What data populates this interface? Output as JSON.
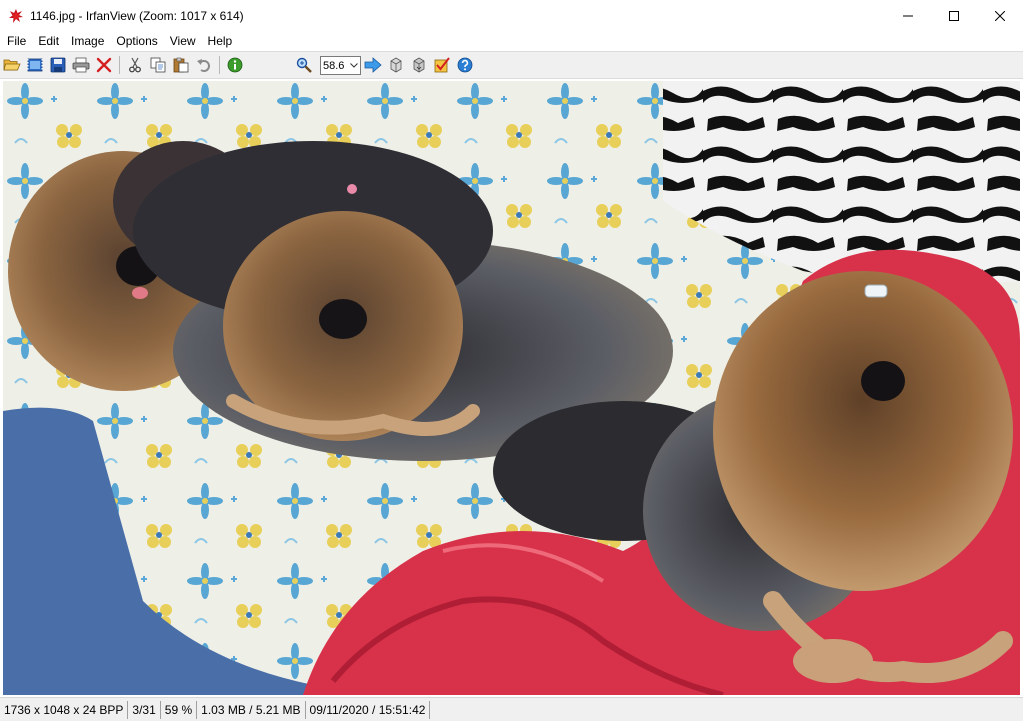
{
  "window": {
    "title": "1146.jpg - IrfanView (Zoom: 1017 x 614)",
    "app_icon": "irfanview-splat-icon",
    "controls": [
      "minimize-icon",
      "maximize-icon",
      "close-icon"
    ]
  },
  "menu": {
    "items": [
      {
        "label": "File"
      },
      {
        "label": "Edit"
      },
      {
        "label": "Image"
      },
      {
        "label": "Options"
      },
      {
        "label": "View"
      },
      {
        "label": "Help"
      }
    ]
  },
  "toolbar": {
    "buttons": [
      {
        "icon": "open-folder-icon"
      },
      {
        "icon": "slideshow-icon"
      },
      {
        "icon": "save-icon"
      },
      {
        "icon": "print-icon"
      },
      {
        "icon": "delete-icon"
      },
      {
        "icon": "cut-icon"
      },
      {
        "icon": "copy-icon"
      },
      {
        "icon": "paste-icon"
      },
      {
        "icon": "undo-icon"
      },
      {
        "icon": "info-icon"
      },
      {
        "icon": "zoom-icon"
      },
      {
        "icon": "next-arrow-icon"
      },
      {
        "icon": "rotate-left-icon"
      },
      {
        "icon": "rotate-right-icon"
      },
      {
        "icon": "check-options-icon"
      },
      {
        "icon": "help-icon"
      }
    ],
    "zoom_value": "58.6",
    "accent": "#2a7fd4"
  },
  "status": {
    "dimensions": "1736 x 1048 x 24 BPP",
    "index": "3/31",
    "zoom": "59 %",
    "size": "1.03 MB / 5.21 MB",
    "datetime": "09/11/2020 / 15:51:42"
  },
  "photo": {
    "colors": {
      "blanket_red": "#d8324a",
      "sofa_blue": "#4a6fa8",
      "pillow_base": "#eef0ea",
      "flower_blue": "#58a6d4",
      "flower_yellow": "#e8cf5a",
      "dog_dark": "#3a3a3e",
      "dog_tan": "#9a6e44"
    }
  }
}
